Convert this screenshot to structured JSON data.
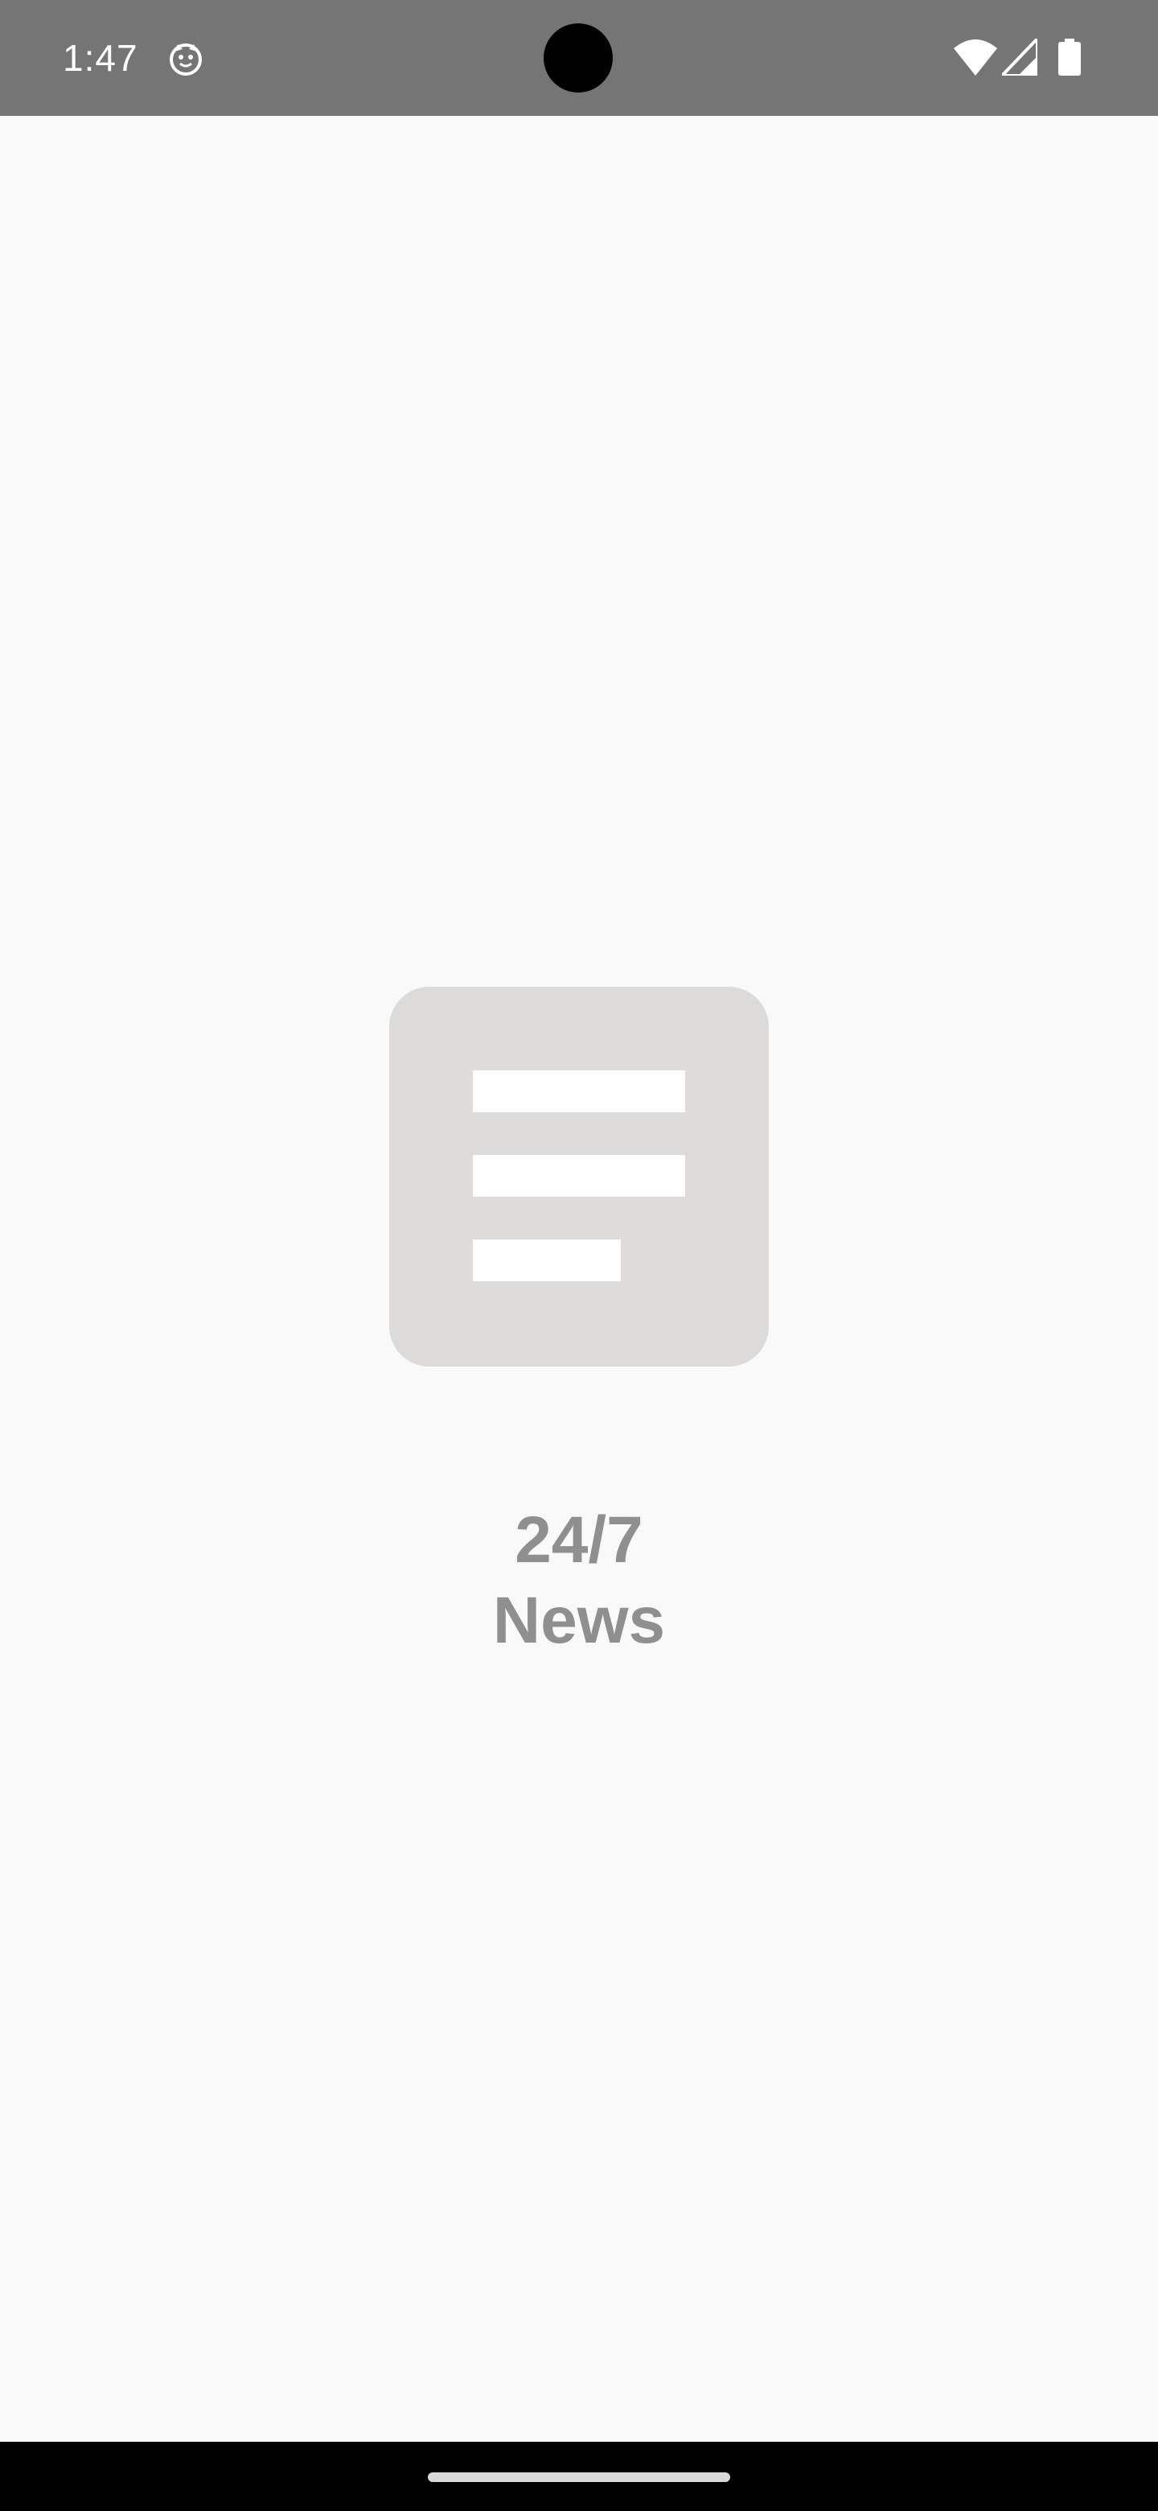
{
  "status_bar": {
    "time": "1:47",
    "icons": [
      "notification-app-icon",
      "wifi-icon",
      "cellular-signal-icon",
      "battery-icon"
    ],
    "background_color": "#757575"
  },
  "splash": {
    "logo_icon": "news-document-icon",
    "logo_color": "#dcdbda",
    "title_line1": "24/7",
    "title_line2": "News",
    "title_color": "#8f8f8f"
  },
  "navigation": {
    "home_indicator_color": "#d9d9d9"
  },
  "page_background": "#f9f9f9"
}
